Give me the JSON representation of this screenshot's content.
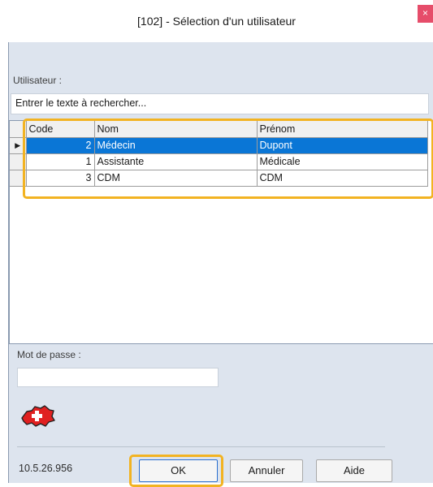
{
  "window": {
    "title": "[102] - Sélection d'un utilisateur",
    "close_glyph": "×"
  },
  "user_section": {
    "label": "Utilisateur :",
    "search_placeholder": "Entrer le texte à rechercher..."
  },
  "grid": {
    "columns": [
      "Code",
      "Nom",
      "Prénom"
    ],
    "rows": [
      {
        "code": "2",
        "nom": "Médecin",
        "prenom": "Dupont",
        "selected": true
      },
      {
        "code": "1",
        "nom": "Assistante",
        "prenom": "Médicale",
        "selected": false
      },
      {
        "code": "3",
        "nom": "CDM",
        "prenom": "CDM",
        "selected": false
      }
    ],
    "row_indicator": "▶"
  },
  "password": {
    "label": "Mot de passe :",
    "value": ""
  },
  "footer": {
    "version": "10.5.26.956",
    "ok_label": "OK",
    "cancel_label": "Annuler",
    "help_label": "Aide"
  },
  "icons": {
    "swiss_flag": "swiss-map-flag-icon"
  },
  "colors": {
    "accent_highlight": "#f2b322",
    "selection": "#0a76d6",
    "close_button": "#e64d6a",
    "panel_background": "#dde4ee"
  }
}
